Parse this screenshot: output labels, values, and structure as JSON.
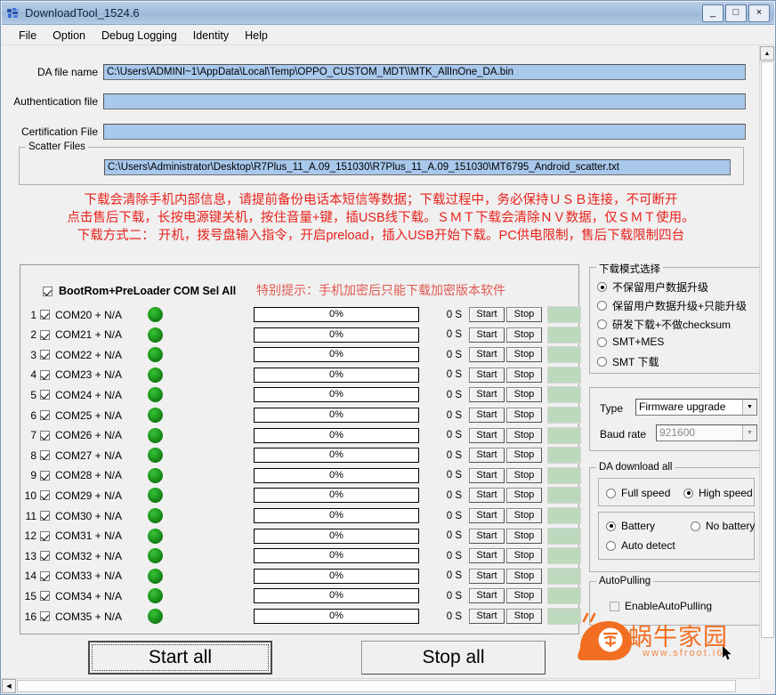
{
  "window": {
    "title": "DownloadTool_1524.6",
    "icon": "app-icon",
    "minimize": "_",
    "maximize": "□",
    "close": "×"
  },
  "menu": {
    "items": [
      {
        "label": "File"
      },
      {
        "label": "Option"
      },
      {
        "label": "Debug Logging"
      },
      {
        "label": "Identity"
      },
      {
        "label": "Help"
      }
    ]
  },
  "files": {
    "da_label": "DA file name",
    "da_value": "C:\\Users\\ADMINI~1\\AppData\\Local\\Temp\\OPPO_CUSTOM_MDT\\\\MTK_AllInOne_DA.bin",
    "auth_label": "Authentication file",
    "auth_value": "",
    "cert_label": "Certification File",
    "cert_value": "",
    "scatter_group_label": "Scatter Files",
    "scatter_value": "C:\\Users\\Administrator\\Desktop\\R7Plus_11_A.09_151030\\R7Plus_11_A.09_151030\\MT6795_Android_scatter.txt"
  },
  "warning": {
    "color": "#e8221c",
    "lines": [
      "下载会清除手机内部信息，请提前备份电话本短信等数据；下载过程中，务必保持ＵＳＢ连接，不可断开",
      "点击售后下载，长按电源键关机，按住音量+键，插USB线下载。ＳＭＴ下载会清除ＮＶ数据，仅ＳＭＴ使用。",
      "下载方式二： 开机，拨号盘输入指令，开启preload，插入USB开始下载。PC供电限制，售后下载限制四台"
    ]
  },
  "com_panel": {
    "select_all_label": "BootRom+PreLoader COM Sel All",
    "select_all_checked": true,
    "tip": "特别提示：手机加密后只能下载加密版本软件",
    "tip_color": "#e05a52",
    "start_label": "Start",
    "stop_label": "Stop",
    "rows": [
      {
        "index": "1",
        "name": "COM20 + N/A",
        "checked": true,
        "led": "green",
        "progress": "0%",
        "time": "0 S"
      },
      {
        "index": "2",
        "name": "COM21 + N/A",
        "checked": true,
        "led": "green",
        "progress": "0%",
        "time": "0 S"
      },
      {
        "index": "3",
        "name": "COM22 + N/A",
        "checked": true,
        "led": "green",
        "progress": "0%",
        "time": "0 S"
      },
      {
        "index": "4",
        "name": "COM23 + N/A",
        "checked": true,
        "led": "green",
        "progress": "0%",
        "time": "0 S"
      },
      {
        "index": "5",
        "name": "COM24 + N/A",
        "checked": true,
        "led": "green",
        "progress": "0%",
        "time": "0 S"
      },
      {
        "index": "6",
        "name": "COM25 + N/A",
        "checked": true,
        "led": "green",
        "progress": "0%",
        "time": "0 S"
      },
      {
        "index": "7",
        "name": "COM26 + N/A",
        "checked": true,
        "led": "green",
        "progress": "0%",
        "time": "0 S"
      },
      {
        "index": "8",
        "name": "COM27 + N/A",
        "checked": true,
        "led": "green",
        "progress": "0%",
        "time": "0 S"
      },
      {
        "index": "9",
        "name": "COM28 + N/A",
        "checked": true,
        "led": "green",
        "progress": "0%",
        "time": "0 S"
      },
      {
        "index": "10",
        "name": "COM29 + N/A",
        "checked": true,
        "led": "green",
        "progress": "0%",
        "time": "0 S"
      },
      {
        "index": "11",
        "name": "COM30 + N/A",
        "checked": true,
        "led": "green",
        "progress": "0%",
        "time": "0 S"
      },
      {
        "index": "12",
        "name": "COM31 + N/A",
        "checked": true,
        "led": "green",
        "progress": "0%",
        "time": "0 S"
      },
      {
        "index": "13",
        "name": "COM32 + N/A",
        "checked": true,
        "led": "green",
        "progress": "0%",
        "time": "0 S"
      },
      {
        "index": "14",
        "name": "COM33 + N/A",
        "checked": true,
        "led": "green",
        "progress": "0%",
        "time": "0 S"
      },
      {
        "index": "15",
        "name": "COM34 + N/A",
        "checked": true,
        "led": "green",
        "progress": "0%",
        "time": "0 S"
      },
      {
        "index": "16",
        "name": "COM35 + N/A",
        "checked": true,
        "led": "green",
        "progress": "0%",
        "time": "0 S"
      }
    ]
  },
  "download_mode": {
    "group_label": "下载模式选择",
    "options": [
      {
        "label": "不保留用户数据升级",
        "selected": true
      },
      {
        "label": "保留用户数据升级+只能升级",
        "selected": false
      },
      {
        "label": "研发下载+不做checksum",
        "selected": false
      },
      {
        "label": "SMT+MES",
        "selected": false
      },
      {
        "label": "SMT 下载",
        "selected": false
      }
    ]
  },
  "type_section": {
    "type_label": "Type",
    "type_value": "Firmware upgrade",
    "baud_label": "Baud rate",
    "baud_value": "921600",
    "baud_disabled": true
  },
  "da_download": {
    "group_label": "DA download all",
    "speed_options": [
      {
        "label": "Full speed",
        "selected": false
      },
      {
        "label": "High speed",
        "selected": true
      }
    ],
    "battery_options": [
      {
        "label": "Battery",
        "selected": true
      },
      {
        "label": "No battery",
        "selected": false
      },
      {
        "label": "Auto detect",
        "selected": false
      }
    ]
  },
  "auto_pulling": {
    "group_label": "AutoPulling",
    "checkbox_label": "EnableAutoPulling",
    "checked": false
  },
  "actions": {
    "start_all": "Start all",
    "stop_all": "Stop all"
  },
  "watermark": {
    "brand": "蜗牛家园",
    "url": "www.sfroot.i6",
    "color": "#f26f21"
  },
  "scrollbars": {
    "up_arrow": "▲",
    "left_arrow": "◀"
  }
}
